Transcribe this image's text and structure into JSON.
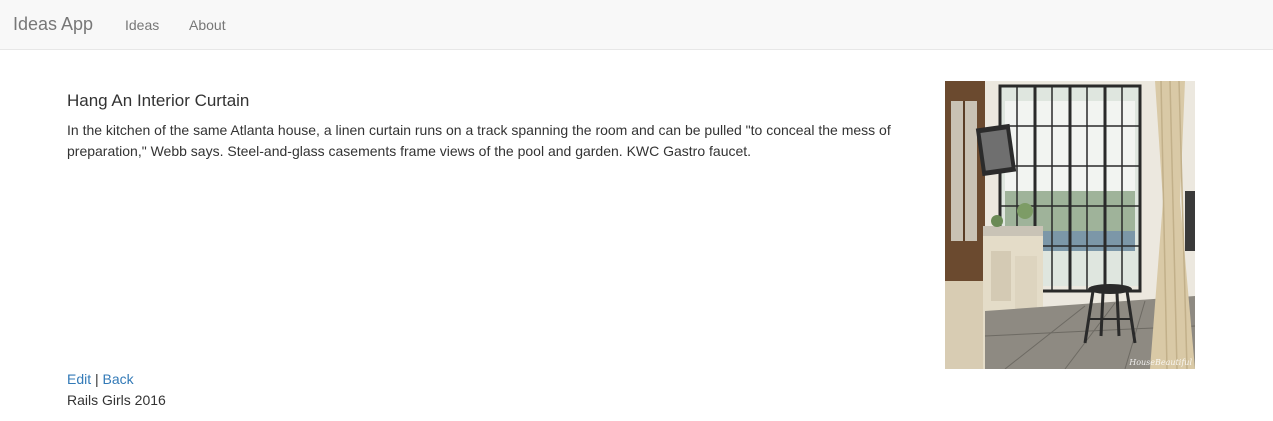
{
  "navbar": {
    "brand": "Ideas App",
    "links": [
      {
        "label": "Ideas"
      },
      {
        "label": "About"
      }
    ]
  },
  "idea": {
    "title": "Hang An Interior Curtain",
    "description": "In the kitchen of the same Atlanta house, a linen curtain runs on a track spanning the room and can be pulled \"to conceal the mess of preparation,\" Webb says. Steel-and-glass casements frame views of the pool and garden. KWC Gastro faucet.",
    "image": {
      "subject": "kitchen-with-linen-curtain",
      "watermark": "HouseBeautiful"
    }
  },
  "actions": {
    "edit": "Edit",
    "separator": "|",
    "back": "Back"
  },
  "footer": {
    "text": "Rails Girls 2016"
  },
  "colors": {
    "navbar_bg": "#f8f8f8",
    "link": "#337ab7",
    "text": "#333333",
    "nav_text": "#777777"
  }
}
